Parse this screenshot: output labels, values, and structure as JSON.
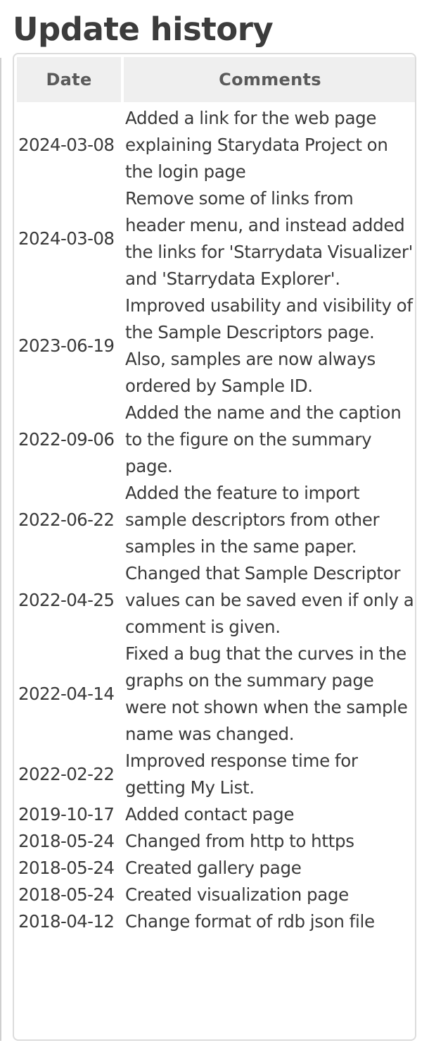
{
  "page": {
    "title": "Update history"
  },
  "table": {
    "columns": [
      "Date",
      "Comments"
    ],
    "rows": [
      {
        "date": "2024-03-08",
        "comment": "Added a link for the web page explaining Starydata Project on the login page"
      },
      {
        "date": "2024-03-08",
        "comment": "Remove some of links from header menu, and instead added the links for 'Starrydata Visualizer' and 'Starrydata Explorer'."
      },
      {
        "date": "2023-06-19",
        "comment": "Improved usability and visibility of the Sample Descriptors page. Also, samples are now always ordered by Sample ID."
      },
      {
        "date": "2022-09-06",
        "comment": "Added the name and the caption to the figure on the summary page."
      },
      {
        "date": "2022-06-22",
        "comment": "Added the feature to import sample descriptors from other samples in the same paper."
      },
      {
        "date": "2022-04-25",
        "comment": "Changed that Sample Descriptor values can be saved even if only a comment is given."
      },
      {
        "date": "2022-04-14",
        "comment": "Fixed a bug that the curves in the graphs on the summary page were not shown when the sample name was changed."
      },
      {
        "date": "2022-02-22",
        "comment": "Improved response time for getting My List."
      },
      {
        "date": "2019-10-17",
        "comment": "Added contact page"
      },
      {
        "date": "2018-05-24",
        "comment": "Changed from http to https"
      },
      {
        "date": "2018-05-24",
        "comment": "Created gallery page"
      },
      {
        "date": "2018-05-24",
        "comment": "Created visualization page"
      },
      {
        "date": "2018-04-12",
        "comment": "Change format of rdb json file"
      }
    ]
  }
}
